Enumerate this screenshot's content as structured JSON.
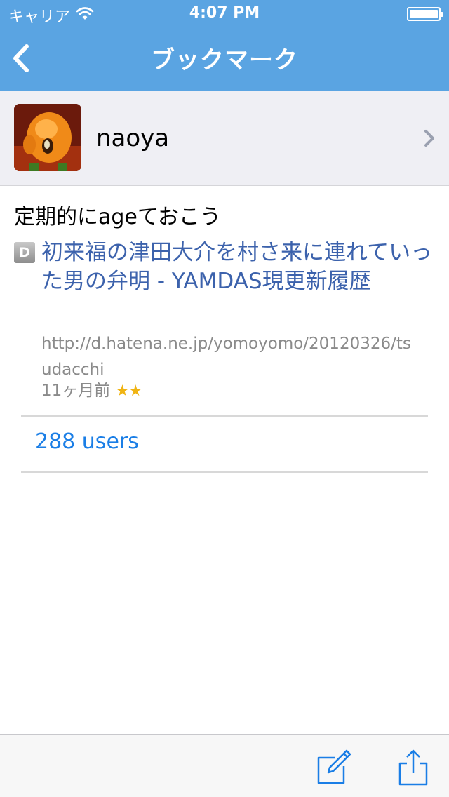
{
  "status_bar": {
    "carrier": "キャリア",
    "time": "4:07 PM"
  },
  "nav": {
    "title": "ブックマーク"
  },
  "user": {
    "name": "naoya"
  },
  "bookmark": {
    "comment": "定期的にageておこう",
    "favicon_letter": "D",
    "title": "初来福の津田大介を村さ来に連れていった男の弁明 - YAMDAS現更新履歴",
    "url": "http://d.hatena.ne.jp/yomoyomo/20120326/tsudacchi",
    "age": "11ヶ月前",
    "stars": "★★"
  },
  "users_link": "288 users",
  "colors": {
    "nav_background": "#5aa4e2",
    "link": "#3c62ac",
    "accent": "#1a7ee6",
    "star": "#f0b413"
  }
}
